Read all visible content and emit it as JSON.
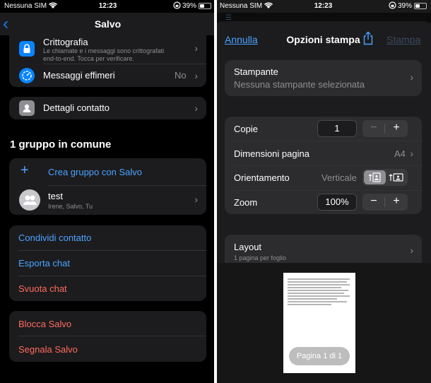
{
  "left": {
    "status": {
      "carrier": "Nessuna SIM",
      "time": "12:23",
      "battery": "39%"
    },
    "nav": {
      "title": "Salvo"
    },
    "encryption": {
      "title": "Crittografia",
      "desc1": "Le chiamate e i messaggi sono crittografati",
      "desc2": "end-to-end. Tocca per verificare."
    },
    "ephemeral": {
      "label": "Messaggi effimeri",
      "value": "No"
    },
    "contact_details": {
      "label": "Dettagli contatto"
    },
    "groups_title": "1 gruppo in comune",
    "create_group": "Crea gruppo con Salvo",
    "group": {
      "name": "test",
      "members": "Irene, Salvo, Tu"
    },
    "actions": {
      "share": "Condividi contatto",
      "export": "Esporta chat",
      "clear": "Svuota chat"
    },
    "danger": {
      "block": "Blocca Salvo",
      "report": "Segnala Salvo"
    }
  },
  "right": {
    "status": {
      "carrier": "Nessuna SIM",
      "time": "12:23",
      "battery": "39%"
    },
    "header": {
      "cancel": "Annulla",
      "title": "Opzioni stampa",
      "print": "Stampa"
    },
    "printer": {
      "label": "Stampante",
      "value": "Nessuna stampante selezionata"
    },
    "copies": {
      "label": "Copie",
      "value": "1"
    },
    "page_size": {
      "label": "Dimensioni pagina",
      "value": "A4"
    },
    "orientation": {
      "label": "Orientamento",
      "value": "Verticale"
    },
    "zoom": {
      "label": "Zoom",
      "value": "100%"
    },
    "layout": {
      "label": "Layout",
      "value": "1 pagina per foglio"
    },
    "preview": {
      "page_label": "Pagina 1 di 1"
    }
  },
  "colors": {
    "accent": "#0a84ff",
    "link": "#4aa3ff",
    "danger": "#ff6b5e"
  }
}
